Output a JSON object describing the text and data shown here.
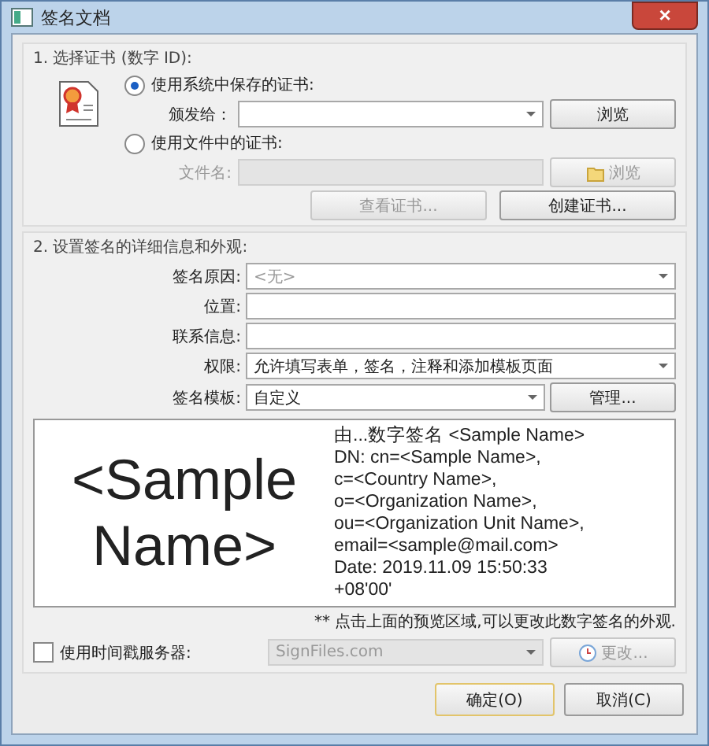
{
  "window": {
    "title": "签名文档",
    "close": "×"
  },
  "section1": {
    "title": "1. 选择证书 (数字 ID):",
    "options": [
      {
        "label": "使用系统中保存的证书:",
        "selected": true,
        "field_label": "颁发给：",
        "kind": "dropdown",
        "button": "浏览",
        "disabled": false
      },
      {
        "label": "使用文件中的证书:",
        "selected": false,
        "field_label": "文件名:",
        "kind": "text",
        "button": "浏览",
        "disabled": true
      }
    ],
    "buttons": [
      {
        "label": "查看证书...",
        "disabled": true
      },
      {
        "label": "创建证书...",
        "disabled": false
      }
    ]
  },
  "section2": {
    "title": "2. 设置签名的详细信息和外观:",
    "fields": [
      {
        "label": "签名原因:",
        "kind": "dropdown",
        "placeholder": "<无>"
      },
      {
        "label": "位置:",
        "kind": "text"
      },
      {
        "label": "联系信息:",
        "kind": "text"
      },
      {
        "label": "权限:",
        "kind": "dropdown",
        "value": "允许填写表单，签名，注释和添加模板页面"
      },
      {
        "label": "签名模板:",
        "kind": "dropdown",
        "value": "自定义",
        "button": "管理..."
      }
    ],
    "preview": {
      "name_lines": [
        "<Sample",
        "Name>"
      ],
      "detail_lines": [
        "由...数字签名 <Sample Name>",
        "DN: cn=<Sample Name>,",
        "c=<Country Name>,",
        "o=<Organization Name>,",
        "ou=<Organization Unit Name>,",
        "email=<sample@mail.com>",
        "Date: 2019.11.09 15:50:33",
        "+08'00'"
      ]
    },
    "hint": "** 点击上面的预览区域,可以更改此数字签名的外观.",
    "timestamp": {
      "label": "使用时间戳服务器:",
      "checked": false,
      "server": "SignFiles.com",
      "button": "更改...",
      "disabled": true
    }
  },
  "buttons": [
    {
      "label": "确定(O)",
      "default": true
    },
    {
      "label": "取消(C)",
      "default": false
    }
  ]
}
